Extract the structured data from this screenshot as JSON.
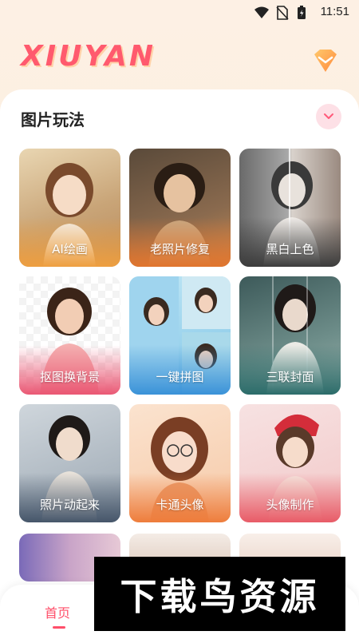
{
  "status_bar": {
    "time": "11:51",
    "icons": [
      "wifi-icon",
      "no-sim-icon",
      "battery-charging-icon"
    ]
  },
  "header": {
    "logo": "XIUYAN",
    "vip_icon": "vip-diamond-icon"
  },
  "section": {
    "title": "图片玩法",
    "expand_icon": "chevron-down-icon"
  },
  "cards": [
    {
      "label": "AI绘画"
    },
    {
      "label": "老照片修复"
    },
    {
      "label": "黑白上色"
    },
    {
      "label": "抠图换背景"
    },
    {
      "label": "一键拼图"
    },
    {
      "label": "三联封面"
    },
    {
      "label": "照片动起来"
    },
    {
      "label": "卡通头像"
    },
    {
      "label": "头像制作"
    }
  ],
  "bottom_nav": {
    "home_label": "首页"
  },
  "watermark": {
    "text": "下载鸟资源"
  },
  "colors": {
    "accent": "#ff4f6a",
    "logo": "#ff5a6e"
  }
}
